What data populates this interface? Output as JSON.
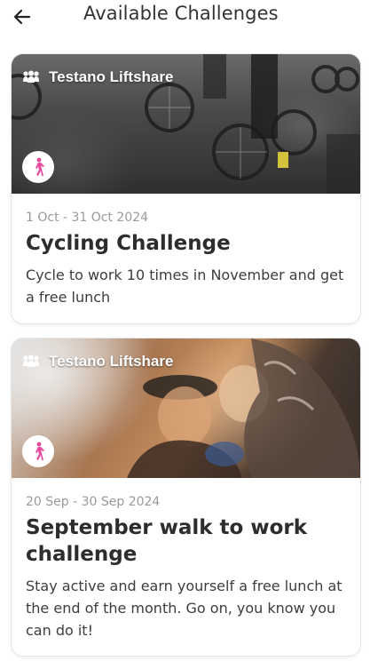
{
  "header": {
    "title": "Available Challenges",
    "back_icon": "arrow-left-icon"
  },
  "challenges": [
    {
      "organization": "Testano Liftshare",
      "organization_icon": "group-icon",
      "activity_icon": "walking-icon",
      "date_range": "1 Oct - 31 Oct 2024",
      "title": "Cycling Challenge",
      "description": "Cycle to work 10 times in November and get a free lunch"
    },
    {
      "organization": "Testano Liftshare",
      "organization_icon": "group-icon",
      "activity_icon": "walking-icon",
      "date_range": "20 Sep - 30 Sep 2024",
      "title": "September walk to work challenge",
      "description": "Stay active and earn yourself a free lunch at the end of the month. Go on, you know you can do it!"
    }
  ],
  "colors": {
    "accent_pink": "#e8479c",
    "title_text": "#2d2d2d",
    "date_text": "#9a9a9a"
  }
}
